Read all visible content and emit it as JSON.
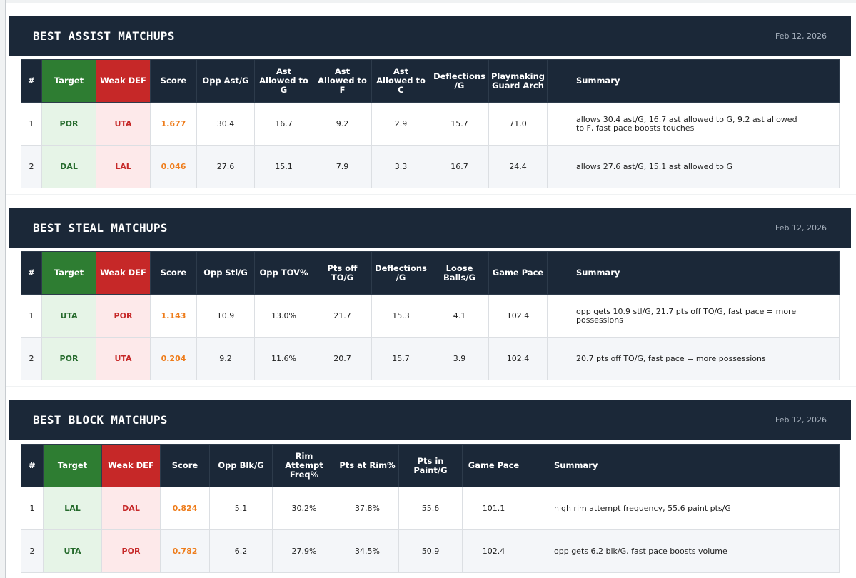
{
  "sections": [
    {
      "title": "BEST ASSIST MATCHUPS",
      "date": "Feb 12, 2026",
      "columns": [
        "#",
        "Target",
        "Weak DEF",
        "Score",
        "Opp Ast/G",
        "Ast Allowed to G",
        "Ast Allowed to F",
        "Ast Allowed to C",
        "Deflections /G",
        "Playmaking Guard Arch",
        "Summary"
      ],
      "rows": [
        [
          "1",
          "POR",
          "UTA",
          "1.677",
          "30.4",
          "16.7",
          "9.2",
          "2.9",
          "15.7",
          "71.0",
          "allows 30.4 ast/G, 16.7 ast allowed to G, 9.2 ast allowed to F, fast pace boosts touches"
        ],
        [
          "2",
          "DAL",
          "LAL",
          "0.046",
          "27.6",
          "15.1",
          "7.9",
          "3.3",
          "16.7",
          "24.4",
          "allows 27.6 ast/G, 15.1 ast allowed to G"
        ]
      ]
    },
    {
      "title": "BEST STEAL MATCHUPS",
      "date": "Feb 12, 2026",
      "columns": [
        "#",
        "Target",
        "Weak DEF",
        "Score",
        "Opp Stl/G",
        "Opp TOV%",
        "Pts off TO/G",
        "Deflections /G",
        "Loose Balls/G",
        "Game Pace",
        "Summary"
      ],
      "rows": [
        [
          "1",
          "UTA",
          "POR",
          "1.143",
          "10.9",
          "13.0%",
          "21.7",
          "15.3",
          "4.1",
          "102.4",
          "opp gets 10.9 stl/G, 21.7 pts off TO/G, fast pace = more possessions"
        ],
        [
          "2",
          "POR",
          "UTA",
          "0.204",
          "9.2",
          "11.6%",
          "20.7",
          "15.7",
          "3.9",
          "102.4",
          "20.7 pts off TO/G, fast pace = more possessions"
        ]
      ]
    },
    {
      "title": "BEST BLOCK MATCHUPS",
      "date": "Feb 12, 2026",
      "columns": [
        "#",
        "Target",
        "Weak DEF",
        "Score",
        "Opp Blk/G",
        "Rim Attempt Freq%",
        "Pts at Rim%",
        "Pts in Paint/G",
        "Game Pace",
        "Summary"
      ],
      "rows": [
        [
          "1",
          "LAL",
          "DAL",
          "0.824",
          "5.1",
          "30.2%",
          "37.8%",
          "55.6",
          "101.1",
          "high rim attempt frequency, 55.6 paint pts/G"
        ],
        [
          "2",
          "UTA",
          "POR",
          "0.782",
          "6.2",
          "27.9%",
          "34.5%",
          "50.9",
          "102.4",
          "opp gets 6.2 blk/G, fast pace boosts volume"
        ]
      ]
    }
  ]
}
